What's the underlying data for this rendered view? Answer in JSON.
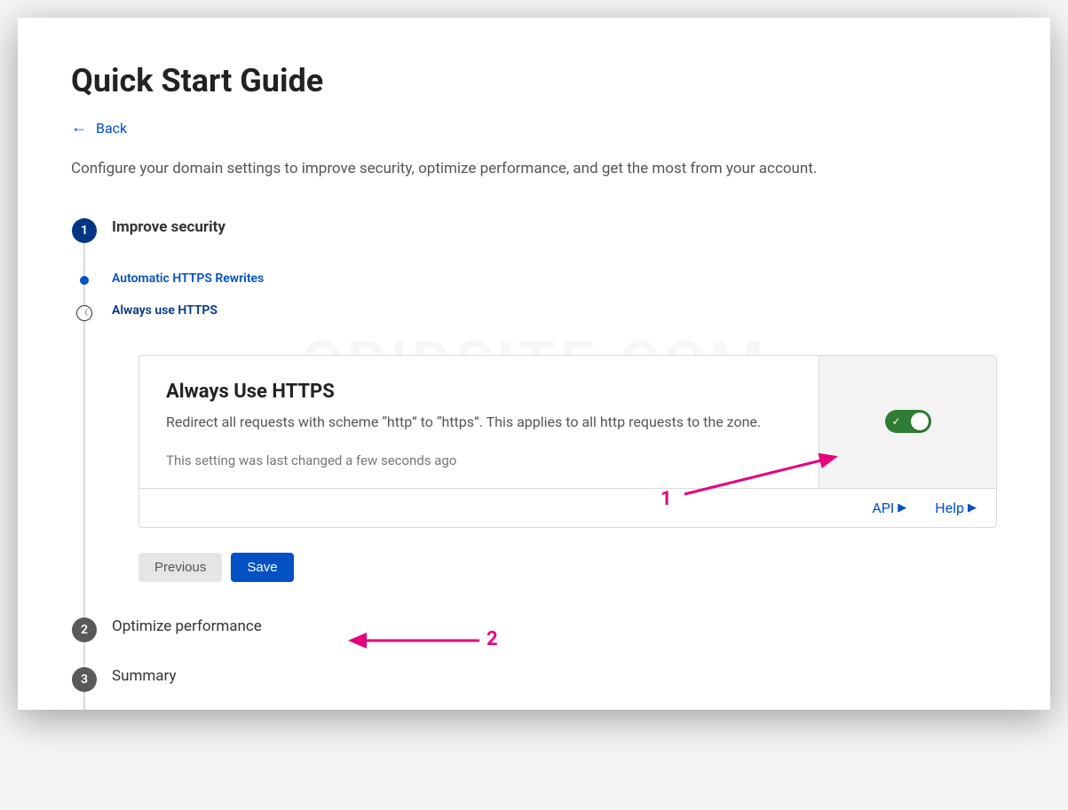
{
  "watermark": "ORIDSITE.COM",
  "header": {
    "title": "Quick Start Guide",
    "back_label": "Back",
    "description": "Configure your domain settings to improve security, optimize performance, and get the most from your account."
  },
  "steps": {
    "step1": {
      "num": "1",
      "label": "Improve security",
      "sub1": "Automatic HTTPS Rewrites",
      "sub2": "Always use HTTPS"
    },
    "step2": {
      "num": "2",
      "label": "Optimize performance"
    },
    "step3": {
      "num": "3",
      "label": "Summary"
    }
  },
  "card": {
    "title": "Always Use HTTPS",
    "desc": "Redirect all requests with scheme “http” to “https”. This applies to all http requests to the zone.",
    "meta": "This setting was last changed a few seconds ago",
    "api_label": "API",
    "help_label": "Help"
  },
  "buttons": {
    "previous": "Previous",
    "save": "Save"
  },
  "annotations": {
    "one": "1",
    "two": "2"
  },
  "colors": {
    "accent": "#0051c3",
    "toggle_on": "#2f7d32",
    "annotation": "#e6007e"
  }
}
